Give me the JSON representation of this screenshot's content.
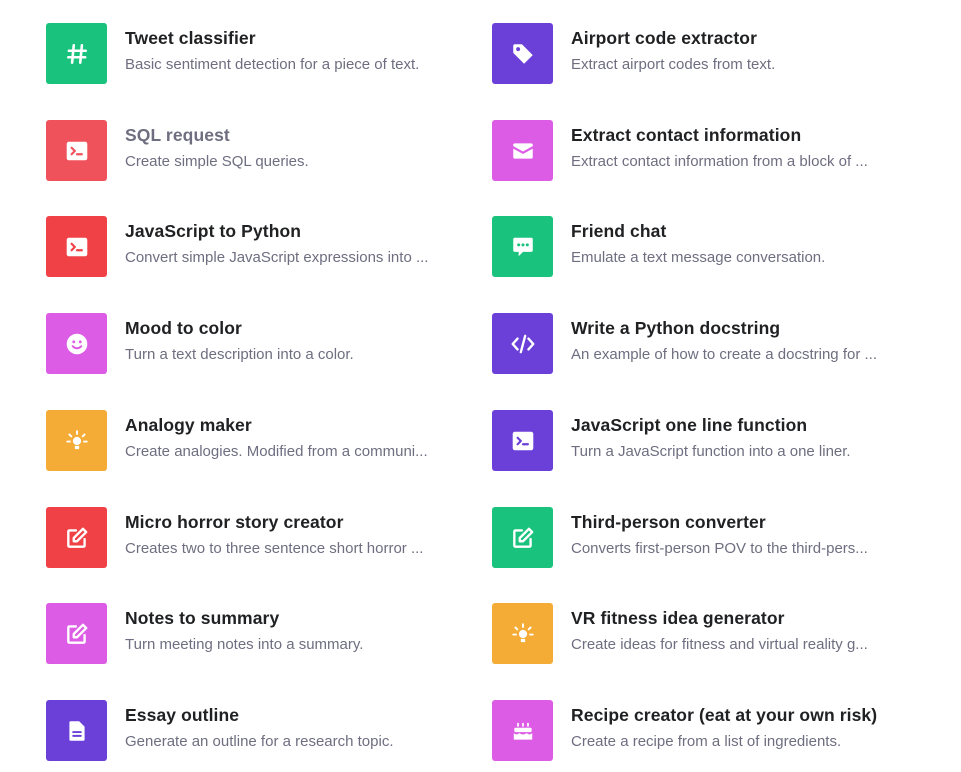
{
  "colors": {
    "green": "#19c37d",
    "purple": "#6b40d8",
    "red": "#ef4146",
    "magenta": "#dd5ce5",
    "orange": "#f4ac36"
  },
  "examples": [
    {
      "title": "Tweet classifier",
      "description": "Basic sentiment detection for a piece of text.",
      "icon": "hashtag-icon",
      "color": "green"
    },
    {
      "title": "Airport code extractor",
      "description": "Extract airport codes from text.",
      "icon": "tag-icon",
      "color": "purple"
    },
    {
      "title": "SQL request",
      "description": "Create simple SQL queries.",
      "icon": "terminal-icon",
      "color": "red"
    },
    {
      "title": "Extract contact information",
      "description": "Extract contact information from a block of ...",
      "icon": "envelope-icon",
      "color": "magenta"
    },
    {
      "title": "JavaScript to Python",
      "description": "Convert simple JavaScript expressions into ...",
      "icon": "terminal-icon",
      "color": "red"
    },
    {
      "title": "Friend chat",
      "description": "Emulate a text message conversation.",
      "icon": "chat-bubble-icon",
      "color": "green"
    },
    {
      "title": "Mood to color",
      "description": "Turn a text description into a color.",
      "icon": "smiley-icon",
      "color": "magenta"
    },
    {
      "title": "Write a Python docstring",
      "description": "An example of how to create a docstring for ...",
      "icon": "code-icon",
      "color": "purple"
    },
    {
      "title": "Analogy maker",
      "description": "Create analogies. Modified from a communi...",
      "icon": "lightbulb-icon",
      "color": "orange"
    },
    {
      "title": "JavaScript one line function",
      "description": "Turn a JavaScript function into a one liner.",
      "icon": "terminal-icon",
      "color": "purple"
    },
    {
      "title": "Micro horror story creator",
      "description": "Creates two to three sentence short horror ...",
      "icon": "edit-icon",
      "color": "red"
    },
    {
      "title": "Third-person converter",
      "description": "Converts first-person POV to the third-pers...",
      "icon": "edit-icon",
      "color": "green"
    },
    {
      "title": "Notes to summary",
      "description": "Turn meeting notes into a summary.",
      "icon": "edit-icon",
      "color": "magenta"
    },
    {
      "title": "VR fitness idea generator",
      "description": "Create ideas for fitness and virtual reality g...",
      "icon": "lightbulb-icon",
      "color": "orange"
    },
    {
      "title": "Essay outline",
      "description": "Generate an outline for a research topic.",
      "icon": "document-icon",
      "color": "purple"
    },
    {
      "title": "Recipe creator (eat at your own risk)",
      "description": "Create a recipe from a list of ingredients.",
      "icon": "cake-icon",
      "color": "magenta"
    }
  ]
}
